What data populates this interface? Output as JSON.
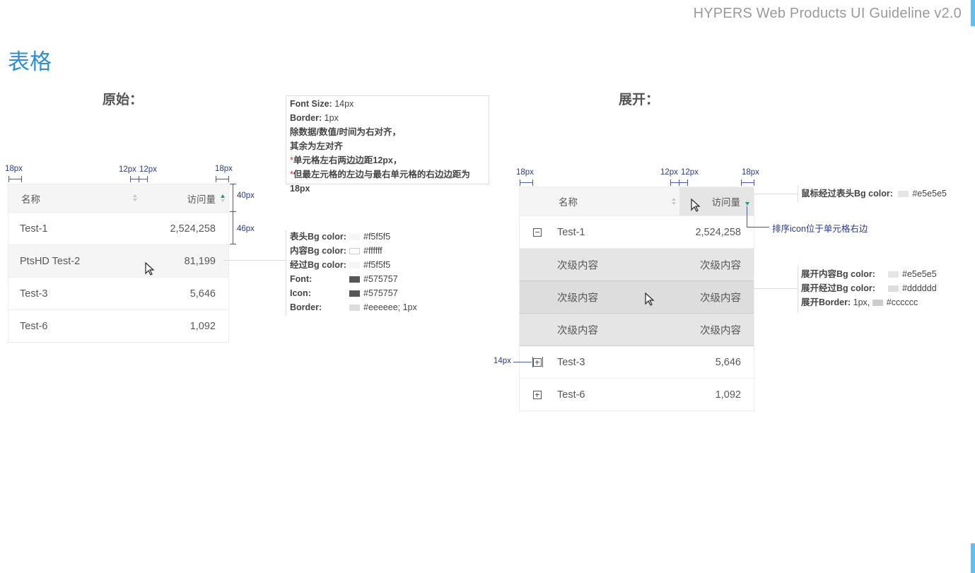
{
  "header": {
    "doc_title": "HYPERS Web Products UI Guideline v2.0"
  },
  "page_title": "表格",
  "sections": {
    "original": "原始：",
    "expanded": "展开："
  },
  "table_original": {
    "col_name": "名称",
    "col_visits": "访问量",
    "rows": [
      {
        "name": "Test-1",
        "value": "2,524,258"
      },
      {
        "name": "PtsHD Test-2",
        "value": "81,199"
      },
      {
        "name": "Test-3",
        "value": "5,646"
      },
      {
        "name": "Test-6",
        "value": "1,092"
      }
    ]
  },
  "table_expanded": {
    "col_name": "名称",
    "col_visits": "访问量",
    "row1": {
      "name": "Test-1",
      "value": "2,524,258"
    },
    "sub_rows": [
      {
        "name": "次级内容",
        "value": "次级内容"
      },
      {
        "name": "次级内容",
        "value": "次级内容"
      },
      {
        "name": "次级内容",
        "value": "次级内容"
      }
    ],
    "row3": {
      "name": "Test-3",
      "value": "5,646"
    },
    "row6": {
      "name": "Test-6",
      "value": "1,092"
    }
  },
  "measures": {
    "px18": "18px",
    "px12": "12px",
    "px40": "40px",
    "px46": "46px",
    "px14": "14px"
  },
  "note": {
    "font_size_k": "Font Size:",
    "font_size_v": " 14px",
    "border_k": "Border:",
    "border_v": " 1px",
    "line3": "除数据/数值/时间为右对齐，",
    "line4": "其余为左对齐",
    "star": "*",
    "line5": "单元格左右两边边距12px，",
    "line6": "但最左元格的左边与最右单元格的右边边距为18px"
  },
  "spec_original": [
    {
      "k": "表头Bg color:",
      "v": "#f5f5f5",
      "color": "#f5f5f5"
    },
    {
      "k": "内容Bg color:",
      "v": "#ffffff",
      "color": "#ffffff"
    },
    {
      "k": "经过Bg color:",
      "v": "#f5f5f5",
      "color": "#f5f5f5"
    },
    {
      "k": "Font:",
      "v": "#575757",
      "color": "#575757"
    },
    {
      "k": "Icon:",
      "v": "#575757",
      "color": "#575757"
    },
    {
      "k": "Border:",
      "v": "#eeeeee; 1px",
      "color": "#eeeeee"
    }
  ],
  "spec_header_hover": {
    "k": "鼠标经过表头Bg color:",
    "v": "#e5e5e5",
    "color": "#e5e5e5"
  },
  "spec_sort_note": "排序icon位于单元格右边",
  "spec_expanded": [
    {
      "k": "展开内容Bg color:",
      "v": "#e5e5e5",
      "color": "#e5e5e5"
    },
    {
      "k": "展开经过Bg color:",
      "v": "#dddddd",
      "color": "#dddddd"
    },
    {
      "k": "展开Border:",
      "pre": "1px, ",
      "v": "#cccccc",
      "color": "#cccccc"
    }
  ]
}
